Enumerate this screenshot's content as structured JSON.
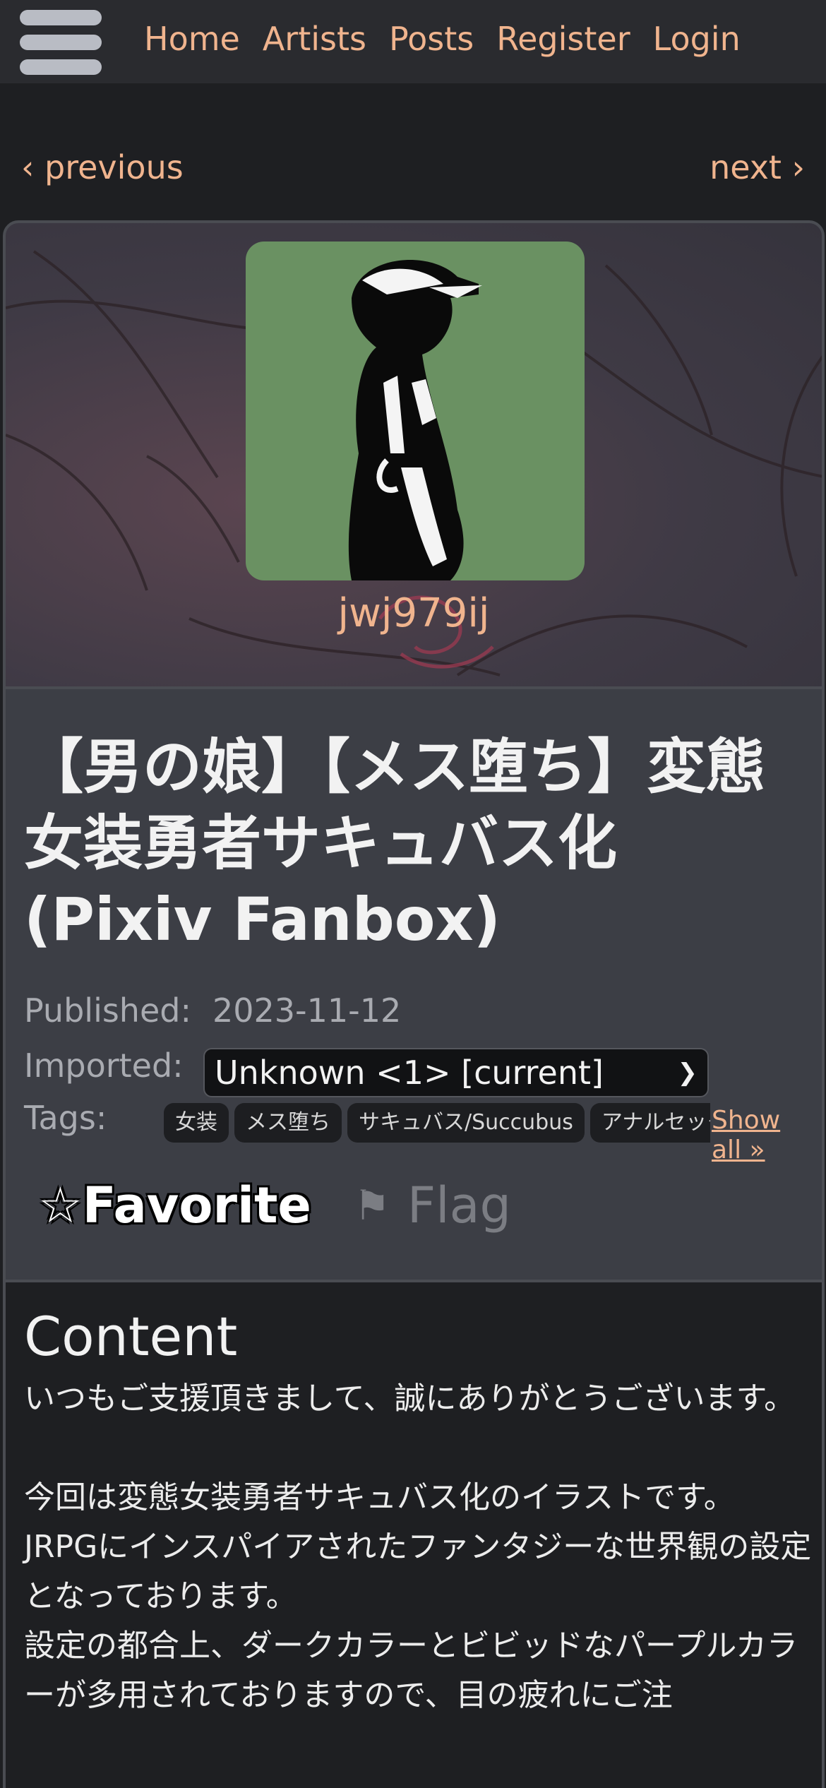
{
  "nav": {
    "links": [
      "Home",
      "Artists",
      "Posts",
      "Register",
      "Login"
    ]
  },
  "pager": {
    "previous": "‹ previous",
    "next": "next ›"
  },
  "artist": {
    "name": "jwj979ij"
  },
  "post": {
    "title": "【男の娘】【メス堕ち】変態女装勇者サキュバス化 (Pixiv Fanbox)",
    "published_label": "Published:",
    "published_value": "2023-11-12",
    "imported_label": "Imported:",
    "imported_value": "Unknown <1> [current]",
    "tags_label": "Tags:",
    "tags": [
      "女装",
      "メス堕ち",
      "サキュバス/Succubus",
      "アナルセックス"
    ],
    "show_all": "Show all »",
    "favorite_label": "Favorite",
    "flag_label": "Flag"
  },
  "icons": {
    "menu": "hamburger-icon",
    "favorite": "star-icon",
    "flag": "flag-icon",
    "select": "chevron-down-icon"
  },
  "content": {
    "heading": "Content",
    "paragraphs": [
      "いつもご支援頂きまして、誠にありがとうございます。",
      "",
      "今回は変態女装勇者サキュバス化のイラストです。",
      "JRPGにインスパイアされたファンタジーな世界観の設定となっております。",
      "設定の都合上、ダークカラーとビビッドなパープルカラーが多用されておりますので、目の疲れにご注"
    ]
  },
  "colors": {
    "accent": "#f0b48e",
    "background": "#1e1f22",
    "panel": "#3c3e45",
    "avatar_bg": "#6a9162"
  }
}
